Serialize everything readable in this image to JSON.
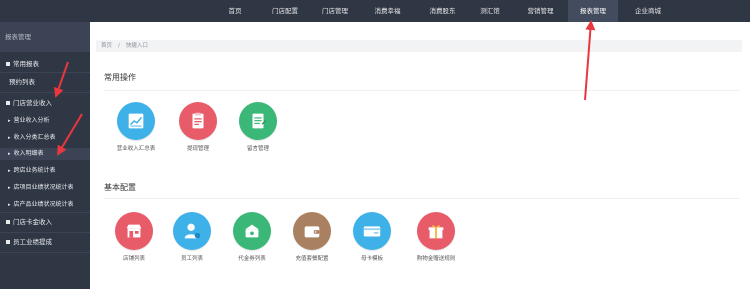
{
  "topnav": {
    "items": [
      "首页",
      "门店配置",
      "门店管理",
      "消费幸福",
      "消费股东",
      "测汇馆",
      "营销管理",
      "报表管理",
      "企业商城"
    ],
    "active_index": 7
  },
  "sidebar": {
    "title": "报表管理",
    "items": [
      {
        "label": "常用报表",
        "level": 1
      },
      {
        "label": "预约列表",
        "level": 1
      },
      {
        "label": "门店营业收入",
        "level": 1
      },
      {
        "label": "营业收入分析",
        "level": 2
      },
      {
        "label": "收入分类汇总表",
        "level": 2
      },
      {
        "label": "收入明细表",
        "level": 2
      },
      {
        "label": "跨店业务统计表",
        "level": 2
      },
      {
        "label": "店项目业绩状况统计表",
        "level": 2
      },
      {
        "label": "店产品业绩状况统计表",
        "level": 2
      },
      {
        "label": "门店卡金收入",
        "level": 1
      },
      {
        "label": "员工业绩提成",
        "level": 1
      }
    ]
  },
  "breadcrumb": {
    "home": "首页",
    "sep": "/",
    "current": "快捷入口"
  },
  "sections": {
    "common": {
      "title": "常用操作",
      "tiles": [
        {
          "label": "营业收入汇总表",
          "color": "#3db1e8",
          "icon": "chart-icon"
        },
        {
          "label": "提现管理",
          "color": "#e85c6a",
          "icon": "clipboard-icon"
        },
        {
          "label": "留言管理",
          "color": "#3bb878",
          "icon": "note-icon"
        }
      ]
    },
    "basic": {
      "title": "基本配置",
      "tiles": [
        {
          "label": "店铺列表",
          "color": "#e85c6a",
          "icon": "store-icon"
        },
        {
          "label": "员工列表",
          "color": "#3db1e8",
          "icon": "staff-icon"
        },
        {
          "label": "代金券列表",
          "color": "#3bb878",
          "icon": "voucher-icon"
        },
        {
          "label": "充值套餐配置",
          "color": "#a98060",
          "icon": "wallet-icon"
        },
        {
          "label": "母卡模板",
          "color": "#3db1e8",
          "icon": "card-icon"
        },
        {
          "label": "购物金赠送规则",
          "color": "#e85c6a",
          "icon": "gift-icon"
        }
      ]
    }
  },
  "colors": {
    "accent_arrow": "#e8373e",
    "nav_bg": "#2f3644"
  }
}
